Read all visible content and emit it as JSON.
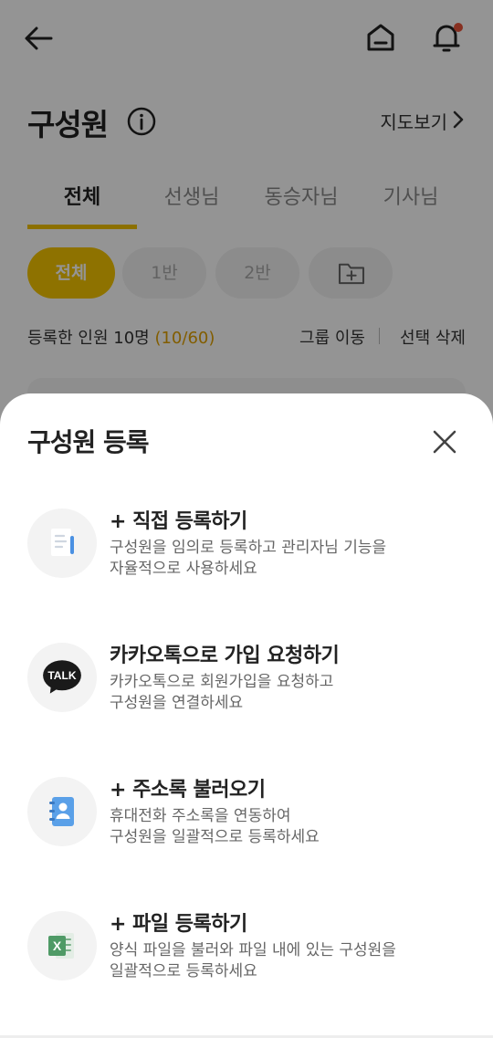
{
  "header": {
    "back_icon": "arrow-left-icon",
    "home_icon": "home-icon",
    "bell_icon": "bell-icon",
    "notification_dot_color": "#e8543a"
  },
  "page": {
    "title": "구성원",
    "map_link": "지도보기",
    "tabs": [
      {
        "label": "전체",
        "active": true
      },
      {
        "label": "선생님",
        "active": false
      },
      {
        "label": "동승자님",
        "active": false
      },
      {
        "label": "기사님",
        "active": false
      }
    ],
    "chips": [
      {
        "label": "전체",
        "active": true
      },
      {
        "label": "1반",
        "active": false
      },
      {
        "label": "2반",
        "active": false
      }
    ],
    "add_folder_icon": "folder-plus-icon",
    "count_label": "등록한 인원 10명",
    "count_value": "(10/60)",
    "group_move": "그룹 이동",
    "delete_selected": "선택 삭제",
    "accent_color": "#f5c400"
  },
  "sheet": {
    "title": "구성원 등록",
    "close_icon": "close-icon",
    "options": [
      {
        "icon": "document-icon",
        "title": "+ 직접 등록하기",
        "desc_line1": "구성원을 임의로 등록하고 관리자님 기능을",
        "desc_line2": "자율적으로 사용하세요"
      },
      {
        "icon": "kakaotalk-icon",
        "icon_text": "TALK",
        "title": "카카오톡으로 가입 요청하기",
        "desc_line1": "카카오톡으로 회원가입을 요청하고",
        "desc_line2": "구성원을 연결하세요"
      },
      {
        "icon": "address-book-icon",
        "title": "+ 주소록 불러오기",
        "desc_line1": "휴대전화 주소록을 연동하여",
        "desc_line2": "구성원을 일괄적으로 등록하세요"
      },
      {
        "icon": "excel-file-icon",
        "icon_text": "X",
        "title": "+ 파일 등록하기",
        "desc_line1": "양식 파일을 불러와 파일 내에 있는 구성원을",
        "desc_line2": "일괄적으로 등록하세요"
      }
    ]
  }
}
